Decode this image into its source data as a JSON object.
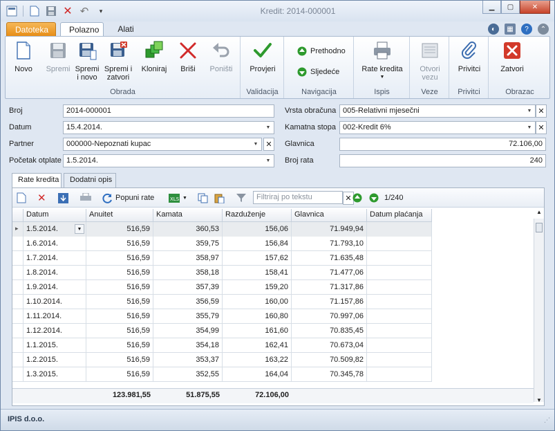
{
  "window": {
    "title": "Kredit: 2014-000001"
  },
  "ribbon": {
    "tabs": [
      "Datoteka",
      "Polazno",
      "Alati"
    ],
    "groups": {
      "obrada": "Obrada",
      "validacija": "Validacija",
      "navigacija": "Navigacija",
      "ispis": "Ispis",
      "veze": "Veze",
      "privitci": "Privitci",
      "obrazac": "Obrazac"
    },
    "buttons": {
      "novo": "Novo",
      "spremi": "Spremi",
      "spremi_novo": "Spremi\ni novo",
      "spremi_zatvori": "Spremi i\nzatvori",
      "kloniraj": "Kloniraj",
      "brisi": "Briši",
      "ponisti": "Poništi",
      "provjeri": "Provjeri",
      "prethodno": "Prethodno",
      "sljedece": "Sljedeće",
      "rate_kredita": "Rate kredita",
      "otvori_vezu": "Otvori\nvezu",
      "privitci": "Privitci",
      "zatvori": "Zatvori"
    }
  },
  "form": {
    "broj_label": "Broj",
    "broj": "2014-000001",
    "datum_label": "Datum",
    "datum": "15.4.2014.",
    "partner_label": "Partner",
    "partner": "000000-Nepoznati kupac",
    "pocetak_label": "Početak otplate",
    "pocetak": "1.5.2014.",
    "vrsta_label": "Vrsta obračuna",
    "vrsta": "005-Relativni mjesečni",
    "kamatna_label": "Kamatna stopa",
    "kamatna": "002-Kredit 6%",
    "glavnica_label": "Glavnica",
    "glavnica": "72.106,00",
    "brojrata_label": "Broj rata",
    "brojrata": "240"
  },
  "subtabs": [
    "Rate kredita",
    "Dodatni opis"
  ],
  "grid_toolbar": {
    "popuni": "Popuni rate",
    "filter_placeholder": "Filtriraj po tekstu",
    "pager": "1/240"
  },
  "grid": {
    "columns": [
      "Datum",
      "Anuitet",
      "Kamata",
      "Razduženje",
      "Glavnica",
      "Datum plaćanja"
    ],
    "rows": [
      [
        "1.5.2014.",
        "516,59",
        "360,53",
        "156,06",
        "71.949,94",
        ""
      ],
      [
        "1.6.2014.",
        "516,59",
        "359,75",
        "156,84",
        "71.793,10",
        ""
      ],
      [
        "1.7.2014.",
        "516,59",
        "358,97",
        "157,62",
        "71.635,48",
        ""
      ],
      [
        "1.8.2014.",
        "516,59",
        "358,18",
        "158,41",
        "71.477,06",
        ""
      ],
      [
        "1.9.2014.",
        "516,59",
        "357,39",
        "159,20",
        "71.317,86",
        ""
      ],
      [
        "1.10.2014.",
        "516,59",
        "356,59",
        "160,00",
        "71.157,86",
        ""
      ],
      [
        "1.11.2014.",
        "516,59",
        "355,79",
        "160,80",
        "70.997,06",
        ""
      ],
      [
        "1.12.2014.",
        "516,59",
        "354,99",
        "161,60",
        "70.835,45",
        ""
      ],
      [
        "1.1.2015.",
        "516,59",
        "354,18",
        "162,41",
        "70.673,04",
        ""
      ],
      [
        "1.2.2015.",
        "516,59",
        "353,37",
        "163,22",
        "70.509,82",
        ""
      ],
      [
        "1.3.2015.",
        "516,59",
        "352,55",
        "164,04",
        "70.345,78",
        ""
      ]
    ],
    "totals": {
      "anuitet": "123.981,55",
      "kamata": "51.875,55",
      "razduzenje": "72.106,00"
    }
  },
  "status": {
    "company": "IPIS d.o.o."
  },
  "colors": {
    "accent": "#e68b14",
    "frame": "#6f88a8",
    "ribbon_bg": "#e6edf6"
  }
}
